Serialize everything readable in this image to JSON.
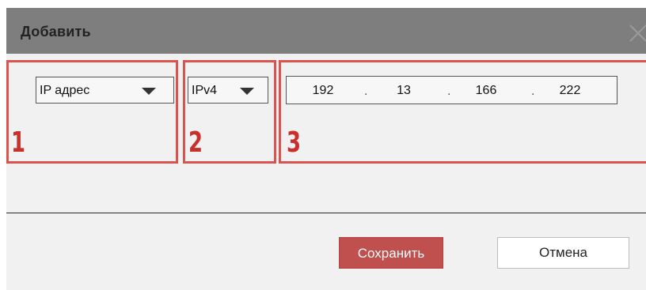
{
  "dialog": {
    "title": "Добавить",
    "close_icon": "close-icon"
  },
  "form": {
    "address_type": {
      "selected": "IP адрес"
    },
    "ip_version": {
      "selected": "IPv4"
    },
    "ip_address": {
      "octets": [
        "192",
        "13",
        "166",
        "222"
      ],
      "separator": "."
    }
  },
  "annotations": {
    "labels": [
      "1",
      "2",
      "3"
    ],
    "color": "#d9534f"
  },
  "buttons": {
    "save_label": "Сохранить",
    "cancel_label": "Отмена"
  },
  "colors": {
    "titlebar": "#7e7e7e",
    "save": "#c0504d",
    "annotation": "#d9534f"
  }
}
